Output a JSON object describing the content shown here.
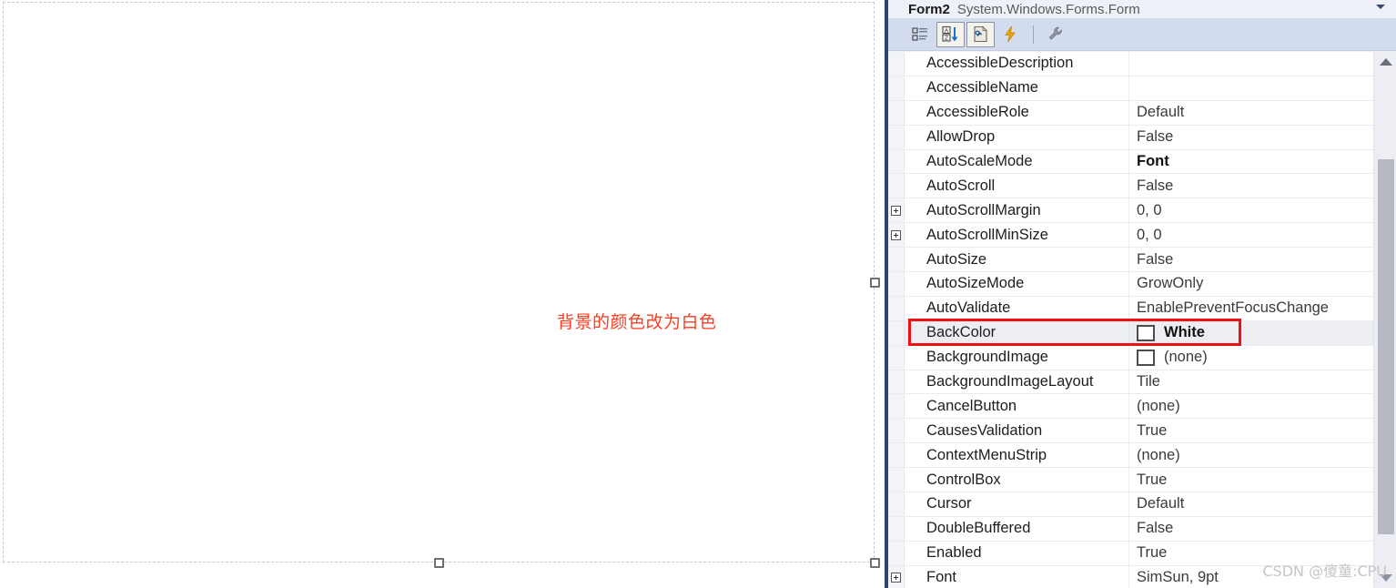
{
  "designer": {
    "annotation": "背景的颜色改为白色",
    "annotation_color": "#fc3d21",
    "surface_background": "#ffffff",
    "handles": [
      "resize-handle-middle-right",
      "resize-handle-bottom-center",
      "resize-handle-bottom-right"
    ]
  },
  "properties_panel": {
    "title": {
      "object_name": "Form2",
      "object_type": "System.Windows.Forms.Form",
      "dropdown_icon": "chevron-down-icon"
    },
    "toolbar": {
      "buttons": [
        {
          "name": "categorized-view-button",
          "icon": "categorized-icon",
          "active": false
        },
        {
          "name": "alphabetical-sort-button",
          "icon": "sort-az-icon",
          "active": true
        },
        {
          "name": "properties-view-button",
          "icon": "properties-page-icon",
          "active": true
        },
        {
          "name": "events-view-button",
          "icon": "lightning-bolt-icon",
          "active": false
        },
        {
          "name": "property-pages-button",
          "icon": "wrench-icon",
          "active": false
        }
      ]
    },
    "rows": [
      {
        "name": "AccessibleDescription",
        "value": "",
        "expandable": false,
        "bold": false,
        "swatch": null,
        "selected": false
      },
      {
        "name": "AccessibleName",
        "value": "",
        "expandable": false,
        "bold": false,
        "swatch": null,
        "selected": false
      },
      {
        "name": "AccessibleRole",
        "value": "Default",
        "expandable": false,
        "bold": false,
        "swatch": null,
        "selected": false
      },
      {
        "name": "AllowDrop",
        "value": "False",
        "expandable": false,
        "bold": false,
        "swatch": null,
        "selected": false
      },
      {
        "name": "AutoScaleMode",
        "value": "Font",
        "expandable": false,
        "bold": true,
        "swatch": null,
        "selected": false
      },
      {
        "name": "AutoScroll",
        "value": "False",
        "expandable": false,
        "bold": false,
        "swatch": null,
        "selected": false
      },
      {
        "name": "AutoScrollMargin",
        "value": "0, 0",
        "expandable": true,
        "bold": false,
        "swatch": null,
        "selected": false
      },
      {
        "name": "AutoScrollMinSize",
        "value": "0, 0",
        "expandable": true,
        "bold": false,
        "swatch": null,
        "selected": false
      },
      {
        "name": "AutoSize",
        "value": "False",
        "expandable": false,
        "bold": false,
        "swatch": null,
        "selected": false
      },
      {
        "name": "AutoSizeMode",
        "value": "GrowOnly",
        "expandable": false,
        "bold": false,
        "swatch": null,
        "selected": false
      },
      {
        "name": "AutoValidate",
        "value": "EnablePreventFocusChange",
        "expandable": false,
        "bold": false,
        "swatch": null,
        "selected": false
      },
      {
        "name": "BackColor",
        "value": "White",
        "expandable": false,
        "bold": true,
        "swatch": "#ffffff",
        "selected": true
      },
      {
        "name": "BackgroundImage",
        "value": "(none)",
        "expandable": false,
        "bold": false,
        "swatch": "#ffffff",
        "selected": false
      },
      {
        "name": "BackgroundImageLayout",
        "value": "Tile",
        "expandable": false,
        "bold": false,
        "swatch": null,
        "selected": false
      },
      {
        "name": "CancelButton",
        "value": "(none)",
        "expandable": false,
        "bold": false,
        "swatch": null,
        "selected": false
      },
      {
        "name": "CausesValidation",
        "value": "True",
        "expandable": false,
        "bold": false,
        "swatch": null,
        "selected": false
      },
      {
        "name": "ContextMenuStrip",
        "value": "(none)",
        "expandable": false,
        "bold": false,
        "swatch": null,
        "selected": false
      },
      {
        "name": "ControlBox",
        "value": "True",
        "expandable": false,
        "bold": false,
        "swatch": null,
        "selected": false
      },
      {
        "name": "Cursor",
        "value": "Default",
        "expandable": false,
        "bold": false,
        "swatch": null,
        "selected": false
      },
      {
        "name": "DoubleBuffered",
        "value": "False",
        "expandable": false,
        "bold": false,
        "swatch": null,
        "selected": false
      },
      {
        "name": "Enabled",
        "value": "True",
        "expandable": false,
        "bold": false,
        "swatch": null,
        "selected": false
      },
      {
        "name": "Font",
        "value": "SimSun, 9pt",
        "expandable": true,
        "bold": false,
        "swatch": null,
        "selected": false
      }
    ],
    "highlight": {
      "target_row": "BackColor",
      "color": "#ee1111"
    },
    "scrollbar": {
      "up_icon": "scroll-up-arrow-icon",
      "down_icon": "scroll-down-arrow-icon"
    }
  },
  "watermark": "CSDN @傻童:CPU"
}
